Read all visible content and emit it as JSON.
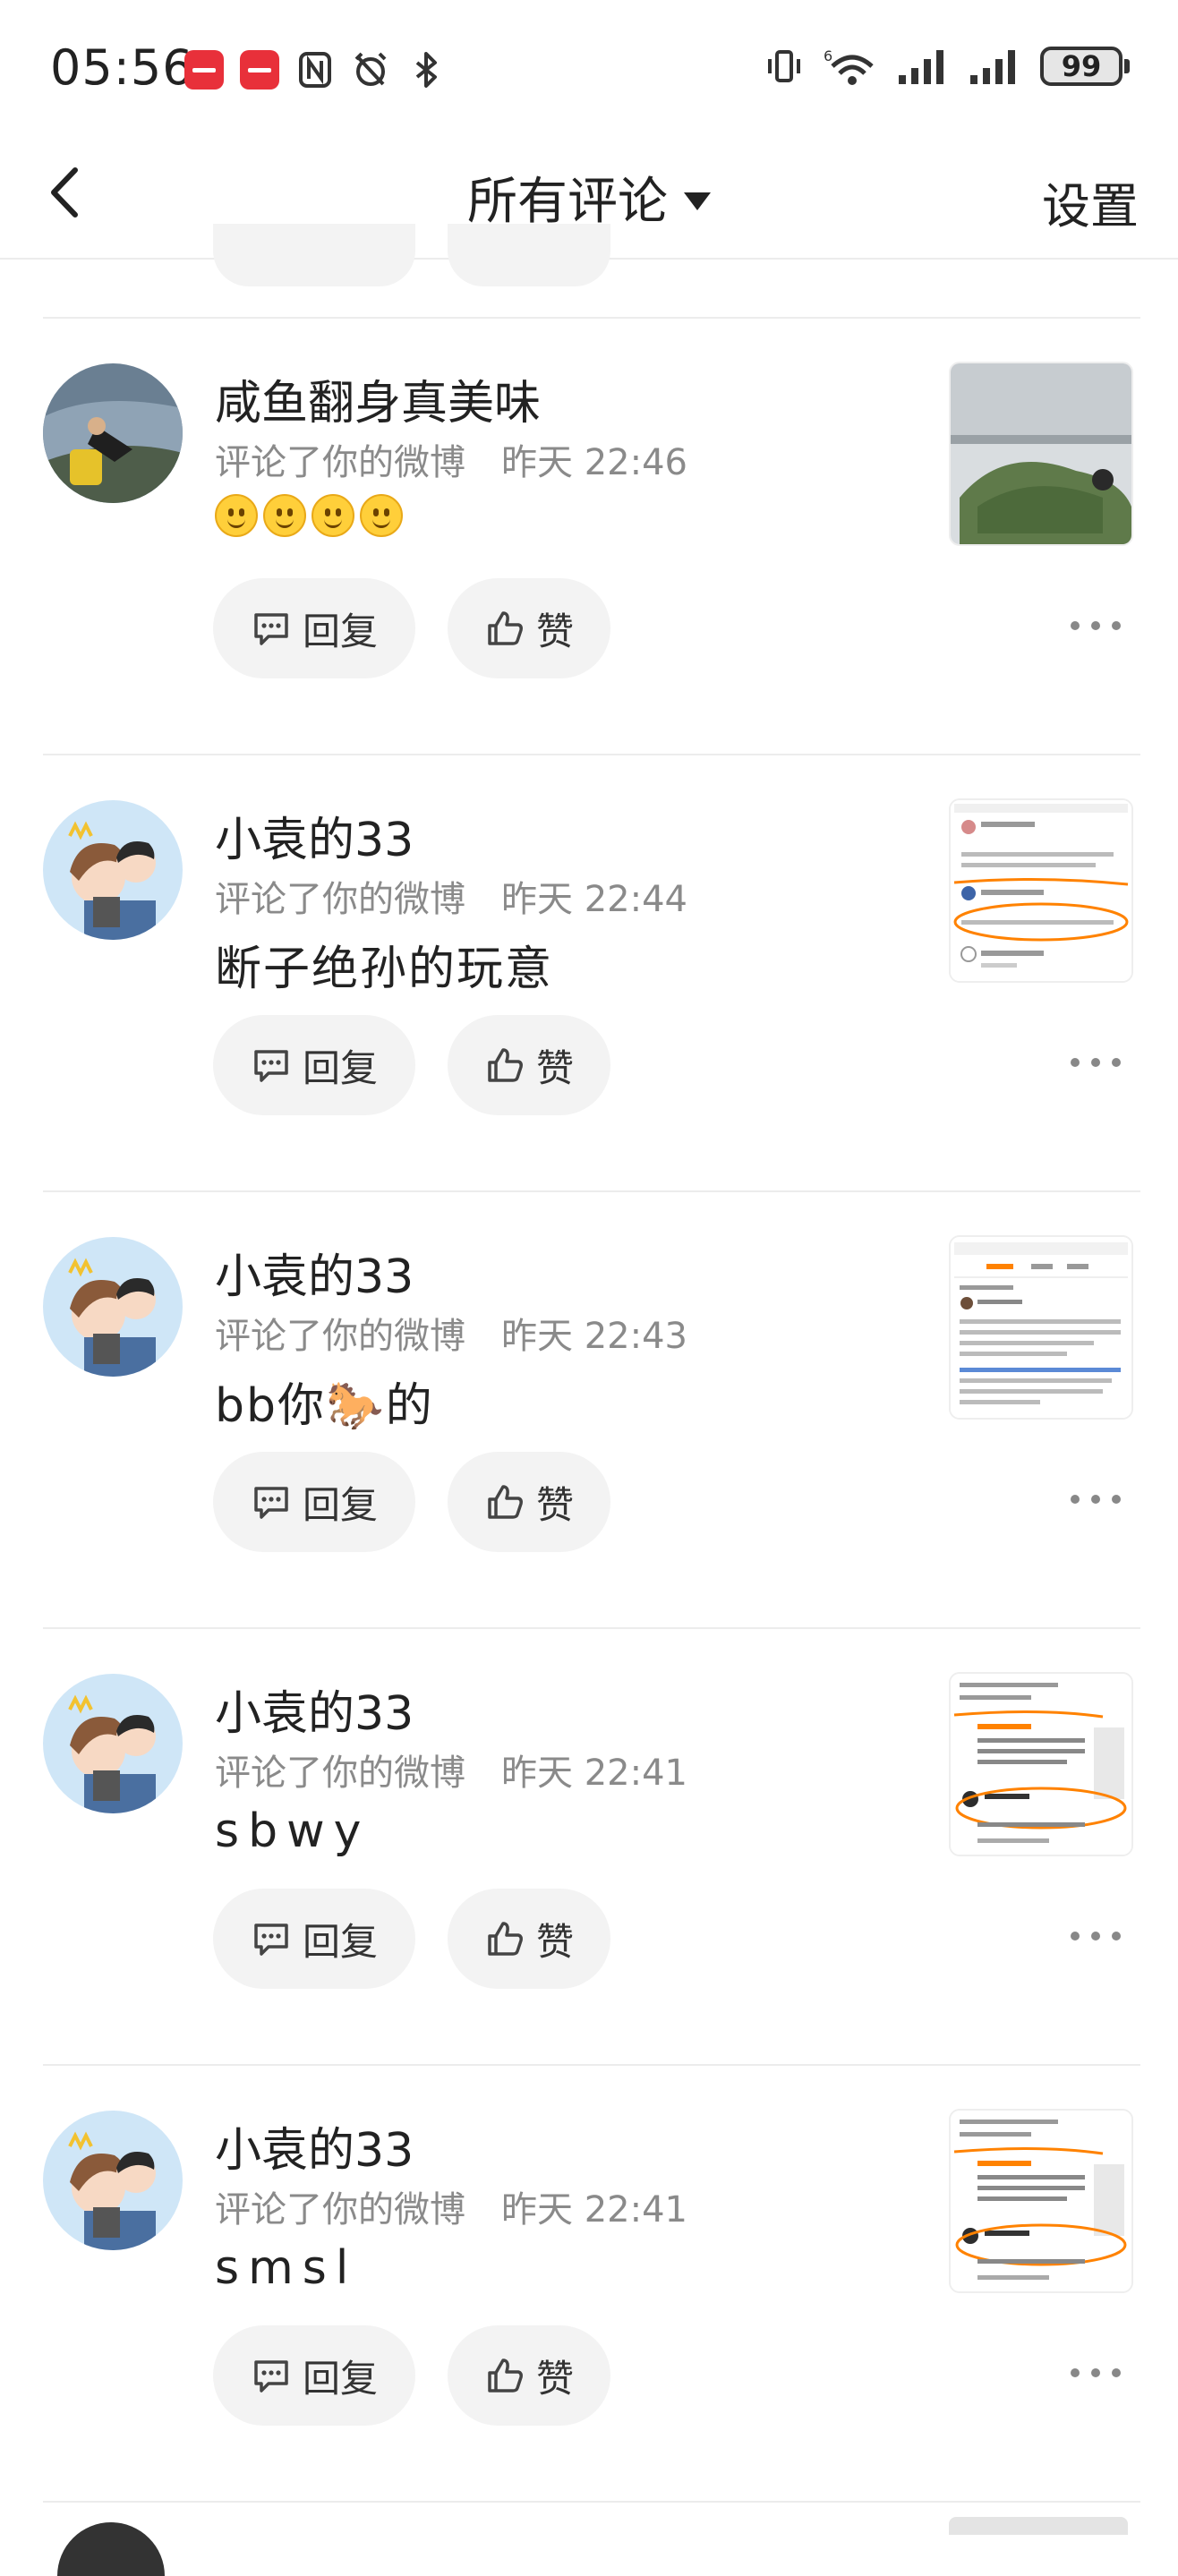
{
  "status_bar": {
    "time": "05:56",
    "battery": "99",
    "network": "6"
  },
  "nav": {
    "title": "所有评论",
    "settings_label": "设置"
  },
  "actions": {
    "reply_label": "回复",
    "like_label": "赞"
  },
  "comments": [
    {
      "username": "咸鱼翻身真美味",
      "action_text": "评论了你的微博",
      "timestamp": "昨天 22:46",
      "content": "",
      "content_emojis": [
        "smile",
        "smile",
        "smile",
        "smile"
      ]
    },
    {
      "username": "小袁的33",
      "action_text": "评论了你的微博",
      "timestamp": "昨天 22:44",
      "content": "断子绝孙的玩意"
    },
    {
      "username": "小袁的33",
      "action_text": "评论了你的微博",
      "timestamp": "昨天 22:43",
      "content": "bb你🐎的"
    },
    {
      "username": "小袁的33",
      "action_text": "评论了你的微博",
      "timestamp": "昨天 22:41",
      "content": "sbwy"
    },
    {
      "username": "小袁的33",
      "action_text": "评论了你的微博",
      "timestamp": "昨天 22:41",
      "content": "smsl"
    }
  ],
  "colors": {
    "accent": "#ff8200",
    "secondary_text": "#8a8a8a",
    "pill_bg": "#f3f3f3",
    "app_icon": "#e8303a"
  },
  "icons": {
    "back": "chevron-left-icon",
    "title_dropdown": "caret-down-icon",
    "reply": "comment-bubble-icon",
    "like": "thumbs-up-icon",
    "more": "ellipsis-icon"
  }
}
